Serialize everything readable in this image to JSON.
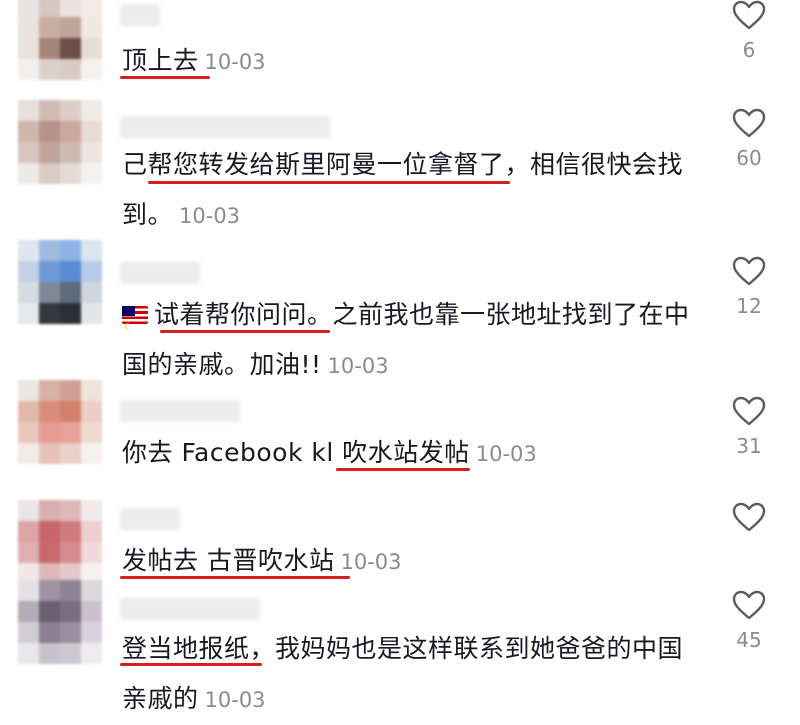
{
  "comments": [
    {
      "text": "顶上去",
      "date": "10-03",
      "likes": "6",
      "avatar_colors": [
        "#e8e4e2",
        "#d6c7c0",
        "#ece3df",
        "#f1ece8",
        "#e9e2de",
        "#c9ada3",
        "#bfa49a",
        "#efe8e3",
        "#ebe2dd",
        "#a68579",
        "#6c5048",
        "#e7ddd7",
        "#f3efec",
        "#dcd0ca",
        "#d9cbc4",
        "#f4f0ed"
      ]
    },
    {
      "text": "己帮您转发给斯里阿曼一位拿督了，相信很快会找到。",
      "date": "10-03",
      "likes": "60",
      "avatar_colors": [
        "#e6dfdc",
        "#d0bcb5",
        "#ddcdc7",
        "#efeae7",
        "#cfb6ad",
        "#b89288",
        "#cba79e",
        "#e6dbd6",
        "#d7c6bf",
        "#c0a49b",
        "#cfbab3",
        "#ece5e1",
        "#efe9e6",
        "#d9cbc5",
        "#e5dbd6",
        "#f4f1ef"
      ]
    },
    {
      "flag": "malaysia-flag",
      "text": "试着帮你问问。之前我也靠一张地址找到了在中国的亲戚。加油!!",
      "date": "10-03",
      "likes": "12",
      "avatar_colors": [
        "#dfe6ef",
        "#9fbbe0",
        "#8fb3e4",
        "#dbe4ef",
        "#c2d1e5",
        "#6d9ad6",
        "#5a8cd4",
        "#b7cbe6",
        "#d4dbe3",
        "#7f8896",
        "#5f6b7c",
        "#cfd6df",
        "#e6e8eb",
        "#34373d",
        "#2c2f35",
        "#e3e5e8"
      ]
    },
    {
      "text": "你去 Facebook kl 吹水站发帖",
      "date": "10-03",
      "likes": "31",
      "avatar_colors": [
        "#ece6e3",
        "#d7b1a3",
        "#cfa194",
        "#efe3dc",
        "#e2b8ad",
        "#d98d79",
        "#d4806e",
        "#ebcfc6",
        "#eac6bf",
        "#e39c92",
        "#e7a39a",
        "#f0d9d3",
        "#f3ebe8",
        "#e6c2ba",
        "#ebd0c9",
        "#f6f0ee"
      ]
    },
    {
      "text": "发帖去 古晋吹水站",
      "date": "10-03",
      "likes": "",
      "avatar_colors": [
        "#ece4e4",
        "#d8aeb0",
        "#dfb9ba",
        "#f2eaea",
        "#dba4a6",
        "#c7666b",
        "#cf7b7f",
        "#eccfd0",
        "#dfaeb0",
        "#c9696e",
        "#d48c8f",
        "#efd9da",
        "#f1e7e7",
        "#dcb8b9",
        "#e5c8c9",
        "#f6f0f0"
      ]
    },
    {
      "text": "登当地报纸，我妈妈也是这样联系到她爸爸的中国亲戚的",
      "date": "10-03",
      "likes": "45",
      "avatar_colors": [
        "#e3e0e5",
        "#9d93a2",
        "#8e8394",
        "#dcd8de",
        "#b4abb8",
        "#6c5f72",
        "#7a6d80",
        "#c9c2cc",
        "#d2cdd5",
        "#8b8091",
        "#9a8fa0",
        "#d8d3da",
        "#e9e7ea",
        "#c8c2cb",
        "#cec8d0",
        "#eeecee"
      ]
    }
  ]
}
